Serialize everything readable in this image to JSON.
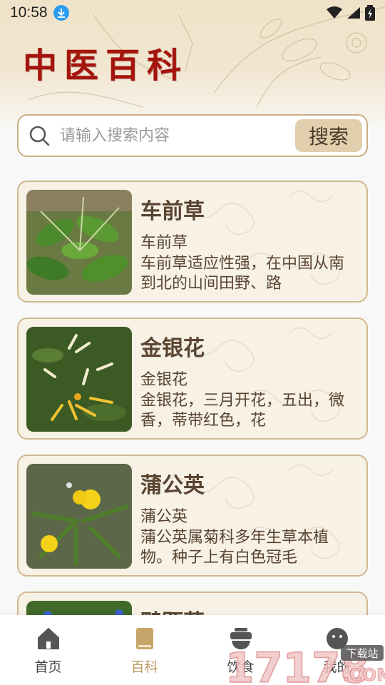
{
  "status_bar": {
    "time": "10:58"
  },
  "header": {
    "title": "中医百科"
  },
  "search": {
    "placeholder": "请输入搜索内容",
    "value": "",
    "button_label": "搜索"
  },
  "cards": [
    {
      "title": "车前草",
      "subtitle": "车前草",
      "description": "车前草适应性强，在中国从南到北的山间田野、路"
    },
    {
      "title": "金银花",
      "subtitle": "金银花",
      "description": "金银花，三月开花，五出，微香，蒂带红色，花"
    },
    {
      "title": "蒲公英",
      "subtitle": "蒲公英",
      "description": "蒲公英属菊科多年生草本植物。种子上有白色冠毛"
    },
    {
      "title": "鸭跖草",
      "subtitle": "",
      "description": ""
    }
  ],
  "nav": {
    "items": [
      {
        "label": "首页",
        "icon": "home-icon"
      },
      {
        "label": "百科",
        "icon": "book-icon",
        "active": true
      },
      {
        "label": "饮食",
        "icon": "food-bowl-icon"
      },
      {
        "label": "我的",
        "icon": "profile-icon"
      }
    ]
  },
  "watermark": {
    "number": "17178",
    "tag": "下载站",
    "suffix": ".COM"
  },
  "colors": {
    "title_red": "#a5140c",
    "card_border": "#d2b890",
    "accent": "#b99760",
    "search_btn_bg": "#e2cfae"
  }
}
